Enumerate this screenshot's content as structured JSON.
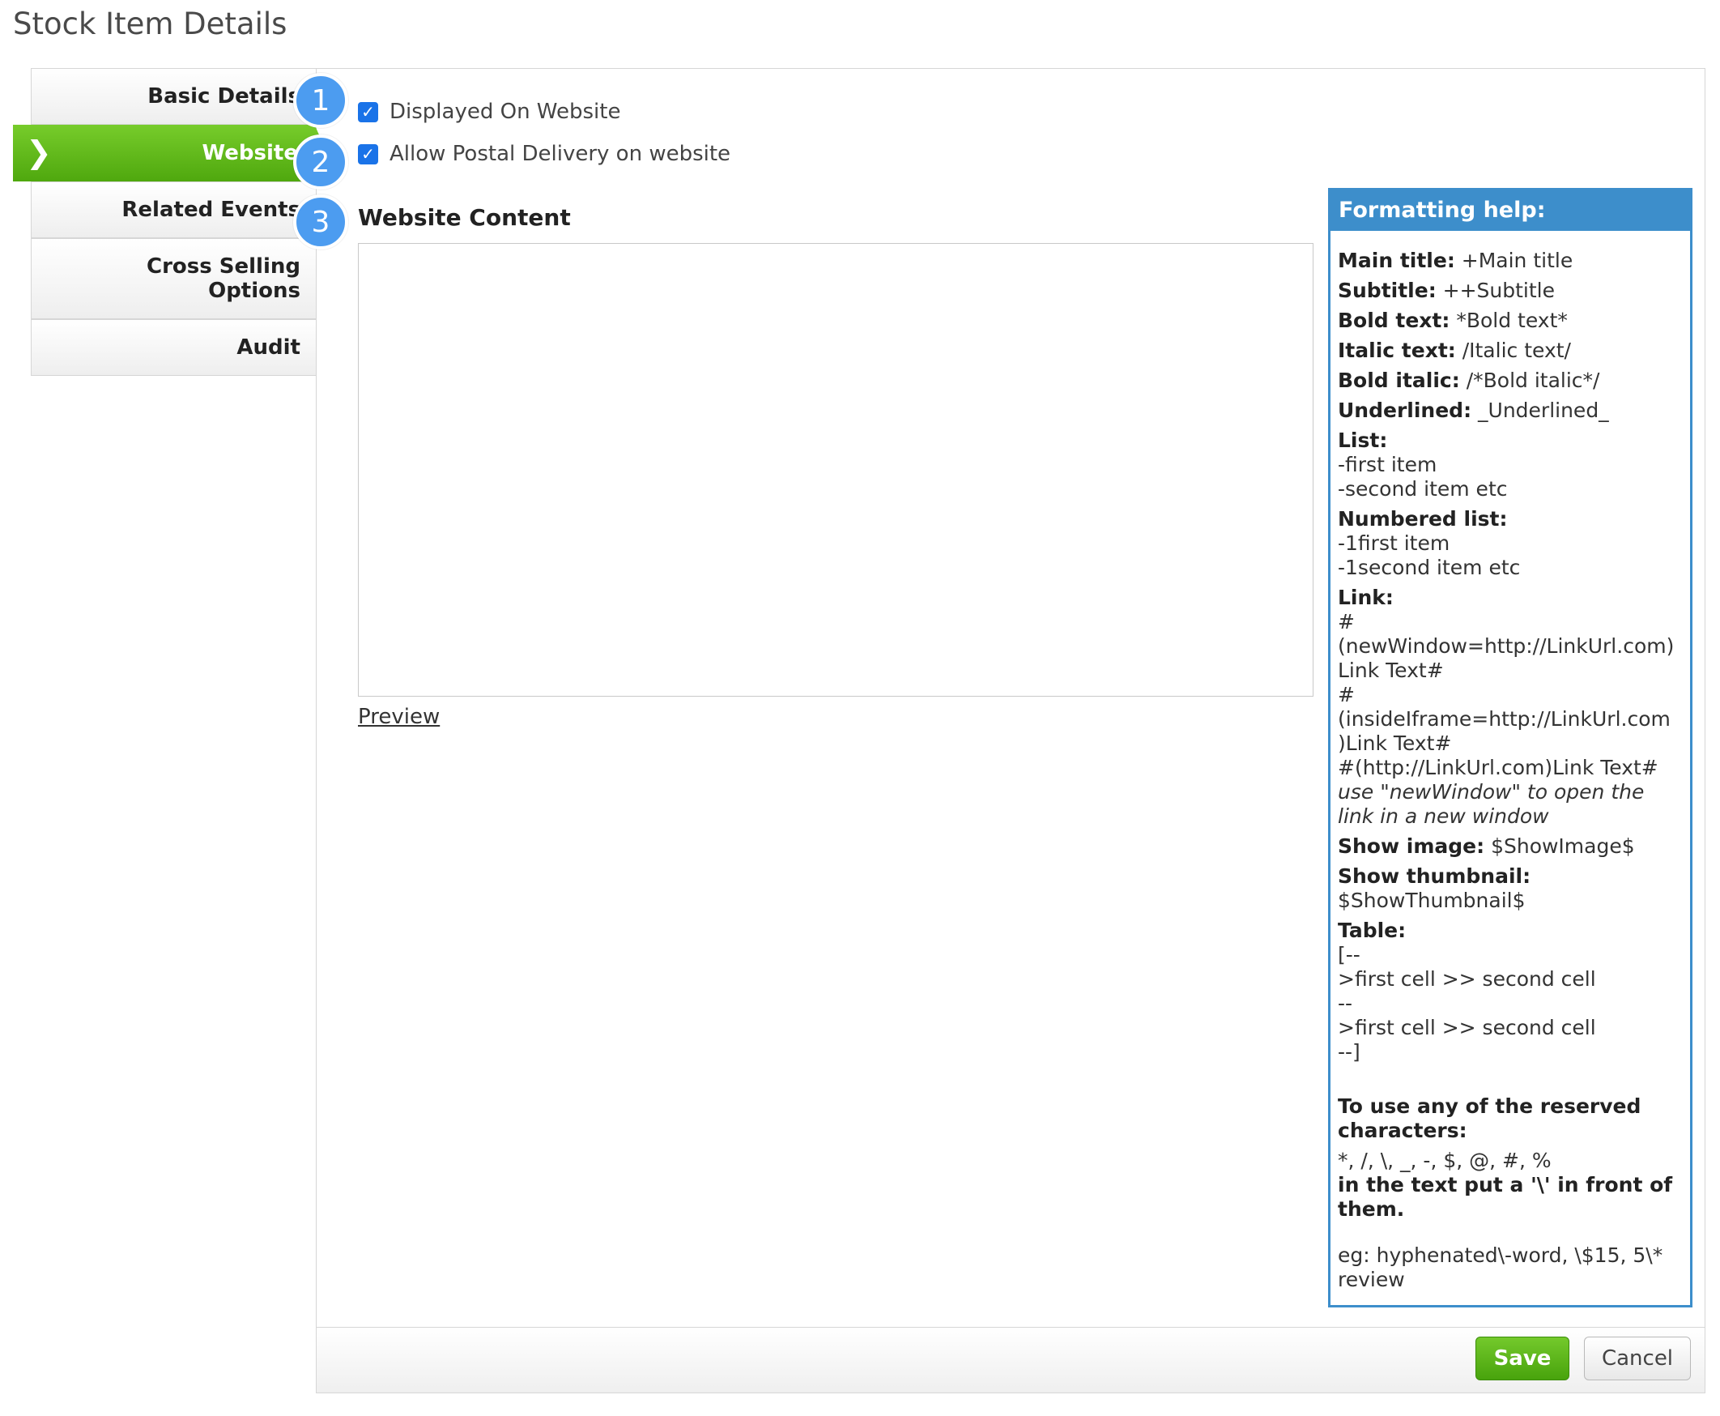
{
  "page_title": "Stock Item Details",
  "tabs": [
    {
      "label": "Basic Details"
    },
    {
      "label": "Website"
    },
    {
      "label": "Related Events"
    },
    {
      "label_line1": "Cross Selling",
      "label_line2": "Options"
    },
    {
      "label": "Audit"
    }
  ],
  "active_tab_chevron": "❯",
  "callouts": [
    "1",
    "2",
    "3"
  ],
  "website": {
    "displayed_on_website": {
      "label": "Displayed On Website",
      "checked": true
    },
    "allow_postal": {
      "label": "Allow Postal Delivery on website",
      "checked": true
    },
    "content_title": "Website Content",
    "content_value": "",
    "preview_label": "Preview"
  },
  "help": {
    "title": "Formatting help:",
    "main_title_k": "Main title:",
    "main_title_v": " +Main title",
    "subtitle_k": "Subtitle:",
    "subtitle_v": " ++Subtitle",
    "bold_k": "Bold text:",
    "bold_v": " *Bold text*",
    "italic_k": "Italic text:",
    "italic_v": " /Italic text/",
    "bolditalic_k": "Bold italic:",
    "bolditalic_v": " /*Bold italic*/",
    "underlined_k": "Underlined:",
    "underlined_v": " _Underlined_",
    "list_k": "List:",
    "list_1": "-first item",
    "list_2": "-second item etc",
    "numbered_k": "Numbered list:",
    "numbered_1": "-1first item",
    "numbered_2": "-1second item etc",
    "link_k": "Link:",
    "link_1a": "#",
    "link_1b": "(newWindow=http://LinkUrl.com)",
    "link_1c": "Link Text#",
    "link_2a": "#",
    "link_2b": "(insideIframe=http://LinkUrl.com",
    "link_2c": ")Link Text#",
    "link_3": "#(http://LinkUrl.com)Link Text#",
    "link_note": "use \"newWindow\" to open the link in a new window",
    "show_image_k": "Show image:",
    "show_image_v": " $ShowImage$",
    "show_thumb_k": "Show thumbnail:",
    "show_thumb_v": "$ShowThumbnail$",
    "table_k": "Table:",
    "table_1": "[--",
    "table_2": ">first cell >> second cell",
    "table_3": "--",
    "table_4": ">first cell >> second cell",
    "table_5": "--]",
    "reserved_k": "To use any of the reserved characters:",
    "reserved_v": "*, /, \\, _, -, $, @, #, %",
    "reserved_k2": "in the text put a '\\' in front of them.",
    "example": "eg: hyphenated\\-word, \\$15, 5\\* review"
  },
  "footer": {
    "save": "Save",
    "cancel": "Cancel"
  },
  "colors": {
    "accent_green": "#5cb515",
    "help_blue": "#3d8ecb",
    "callout_blue": "#4c9cf0",
    "checkbox_blue": "#1a73e8"
  }
}
